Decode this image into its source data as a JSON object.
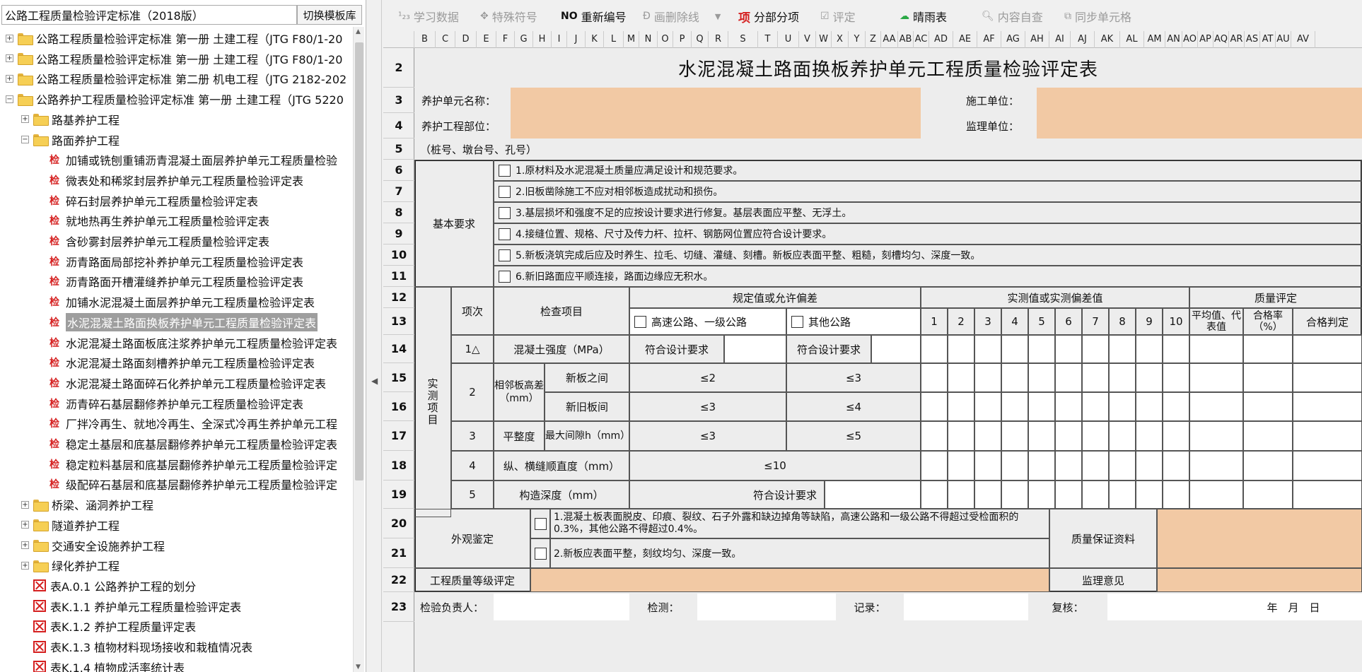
{
  "library": {
    "selected": "公路工程质量检验评定标准（2018版）",
    "switch_label": "切换模板库"
  },
  "tree": [
    {
      "label": "公路工程质量检验评定标准 第一册 土建工程（JTG F80/1-20",
      "type": "folder",
      "exp": "+"
    },
    {
      "label": "公路工程质量检验评定标准 第一册 土建工程（JTG F80/1-20",
      "type": "folder",
      "exp": "+"
    },
    {
      "label": "公路工程质量检验评定标准 第二册 机电工程（JTG 2182-202",
      "type": "folder",
      "exp": "+"
    },
    {
      "label": "公路养护工程质量检验评定标准 第一册 土建工程（JTG 5220",
      "type": "folder-open",
      "exp": "−"
    },
    {
      "label": "路基养护工程",
      "type": "folder",
      "exp": "+"
    },
    {
      "label": "路面养护工程",
      "type": "folder-open",
      "exp": "−"
    },
    {
      "label": "加铺或铣刨重铺沥青混凝土面层养护单元工程质量检验",
      "type": "doc"
    },
    {
      "label": "微表处和稀浆封层养护单元工程质量检验评定表",
      "type": "doc"
    },
    {
      "label": "碎石封层养护单元工程质量检验评定表",
      "type": "doc"
    },
    {
      "label": "就地热再生养护单元工程质量检验评定表",
      "type": "doc"
    },
    {
      "label": "含砂雾封层养护单元工程质量检验评定表",
      "type": "doc"
    },
    {
      "label": "沥青路面局部挖补养护单元工程质量检验评定表",
      "type": "doc"
    },
    {
      "label": "沥青路面开槽灌缝养护单元工程质量检验评定表",
      "type": "doc"
    },
    {
      "label": "加铺水泥混凝土面层养护单元工程质量检验评定表",
      "type": "doc"
    },
    {
      "label": "水泥混凝土路面换板养护单元工程质量检验评定表",
      "type": "doc",
      "selected": true
    },
    {
      "label": "水泥混凝土路面板底注浆养护单元工程质量检验评定表",
      "type": "doc"
    },
    {
      "label": "水泥混凝土路面刻槽养护单元工程质量检验评定表",
      "type": "doc"
    },
    {
      "label": "水泥混凝土路面碎石化养护单元工程质量检验评定表",
      "type": "doc"
    },
    {
      "label": "沥青碎石基层翻修养护单元工程质量检验评定表",
      "type": "doc"
    },
    {
      "label": "厂拌冷再生、就地冷再生、全深式冷再生养护单元工程",
      "type": "doc"
    },
    {
      "label": "稳定土基层和底基层翻修养护单元工程质量检验评定表",
      "type": "doc"
    },
    {
      "label": "稳定粒料基层和底基层翻修养护单元工程质量检验评定",
      "type": "doc"
    },
    {
      "label": "级配碎石基层和底基层翻修养护单元工程质量检验评定",
      "type": "doc"
    },
    {
      "label": "桥梁、涵洞养护工程",
      "type": "folder",
      "exp": "+"
    },
    {
      "label": "隧道养护工程",
      "type": "folder",
      "exp": "+"
    },
    {
      "label": "交通安全设施养护工程",
      "type": "folder",
      "exp": "+"
    },
    {
      "label": "绿化养护工程",
      "type": "folder",
      "exp": "+"
    },
    {
      "label": "表A.0.1 公路养护工程的划分",
      "type": "form"
    },
    {
      "label": "表K.1.1 养护单元工程质量检验评定表",
      "type": "form"
    },
    {
      "label": "表K.1.2 养护工程质量评定表",
      "type": "form"
    },
    {
      "label": "表K.1.3 植物材料现场接收和栽植情况表",
      "type": "form"
    },
    {
      "label": "表K.1.4 植物成活率统计表",
      "type": "form"
    }
  ],
  "toolbar": {
    "learn": "学习数据",
    "special": "特殊符号",
    "renumber": "重新编号",
    "strike": "画删除线",
    "subitem": "分部分项",
    "evaluate": "评定",
    "weather": "晴雨表",
    "selfcheck": "内容自查",
    "sync": "同步单元格"
  },
  "columns": [
    "B",
    "C",
    "D",
    "E",
    "F",
    "G",
    "H",
    "I",
    "J",
    "K",
    "L",
    "M",
    "N",
    "O",
    "P",
    "Q",
    "R",
    "S",
    "T",
    "U",
    "V",
    "W",
    "X",
    "Y",
    "Z",
    "AA",
    "AB",
    "AC",
    "AD",
    "AE",
    "AF",
    "AG",
    "AH",
    "AI",
    "AJ",
    "AK",
    "AL",
    "AM",
    "AN",
    "AO",
    "AP",
    "AQ",
    "AR",
    "AS",
    "AT",
    "AU",
    "AV"
  ],
  "rows": [
    "2",
    "3",
    "4",
    "5",
    "6",
    "7",
    "8",
    "9",
    "10",
    "11",
    "12",
    "13",
    "14",
    "15",
    "16",
    "17",
    "18",
    "19",
    "20",
    "21",
    "22",
    "23"
  ],
  "form": {
    "title": "水泥混凝土路面换板养护单元工程质量检验评定表",
    "unit_name_label": "养护单元名称：",
    "construction_unit_label": "施工单位：",
    "part_label": "养护工程部位：",
    "supervision_unit_label": "监理单位：",
    "stake_note": "（桩号、墩台号、孔号）",
    "basic_req_label": "基本要求",
    "basic_reqs": [
      "1.原材料及水泥混凝土质量应满足设计和规范要求。",
      "2.旧板凿除施工不应对相邻板造成扰动和损伤。",
      "3.基层损坏和强度不足的应按设计要求进行修复。基层表面应平整、无浮土。",
      "4.接缝位置、规格、尺寸及传力杆、拉杆、钢筋网位置应符合设计要求。",
      "5.新板浇筑完成后应及时养生、拉毛、切缝、灌缝、刻槽。新板应表面平整、粗糙，刻槽均匀、深度一致。",
      "6.新旧路面应平顺连接，路面边缘应无积水。"
    ],
    "measured_label": "实测项目",
    "item_no_label": "项次",
    "check_item_label": "检查项目",
    "spec_label": "规定值或允许偏差",
    "highway_label": "高速公路、一级公路",
    "other_road_label": "其他公路",
    "actual_label": "实测值或实测偏差值",
    "measure_nums": [
      "1",
      "2",
      "3",
      "4",
      "5",
      "6",
      "7",
      "8",
      "9",
      "10"
    ],
    "quality_label": "质量评定",
    "avg_label": "平均值、代表值",
    "pass_rate_label": "合格率（%）",
    "judge_label": "合格判定",
    "items": {
      "r1_no": "1△",
      "r1_name": "混凝土强度（MPa）",
      "r1_high": "符合设计要求",
      "r1_other": "符合设计要求",
      "r2_no": "2",
      "r2_name": "相邻板高差（mm）",
      "r2a_sub": "新板之间",
      "r2a_high": "≤2",
      "r2a_other": "≤3",
      "r2b_sub": "新旧板间",
      "r2b_high": "≤3",
      "r2b_other": "≤4",
      "r3_no": "3",
      "r3_name": "平整度",
      "r3_sub": "最大间隙h（mm）",
      "r3_high": "≤3",
      "r3_other": "≤5",
      "r4_no": "4",
      "r4_name": "纵、横缝顺直度（mm）",
      "r4_val": "≤10",
      "r5_no": "5",
      "r5_name": "构造深度（mm）",
      "r5_val": "符合设计要求"
    },
    "appearance_label": "外观鉴定",
    "appearance_1": "1.混凝土板表面脱皮、印痕、裂纹、石子外露和缺边掉角等缺陷，高速公路和一级公路不得超过受检面积的0.3%，其他公路不得超过0.4%。",
    "appearance_2": "2.新板应表面平整，刻纹均匀、深度一致。",
    "quality_docs_label": "质量保证资料",
    "grade_label": "工程质量等级评定",
    "supervision_opinion_label": "监理意见",
    "inspector_label": "检验负责人：",
    "detect_label": "检测：",
    "record_label": "记录：",
    "review_label": "复核：",
    "date_label": "年　月　日"
  }
}
